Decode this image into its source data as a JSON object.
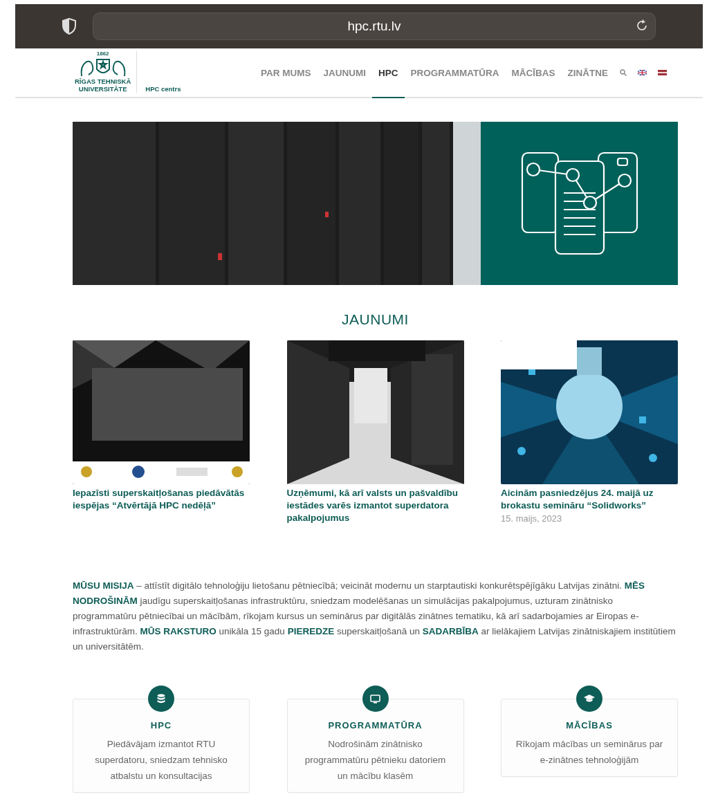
{
  "browser": {
    "url": "hpc.rtu.lv"
  },
  "header": {
    "logo": {
      "year": "1862",
      "name_line1": "RĪGAS TEHNISKĀ",
      "name_line2": "UNIVERSITĀTE",
      "subtitle": "HPC centrs"
    },
    "nav": [
      {
        "label": "PAR MUMS",
        "selected": false
      },
      {
        "label": "JAUNUMI",
        "selected": false
      },
      {
        "label": "HPC",
        "selected": true
      },
      {
        "label": "PROGRAMMATŪRA",
        "selected": false
      },
      {
        "label": "MĀCĪBAS",
        "selected": false
      },
      {
        "label": "ZINĀTNE",
        "selected": false
      }
    ]
  },
  "news": {
    "heading": "JAUNUMI",
    "items": [
      {
        "title": "Iepazīsti superskaitļošanas piedāvātās iespējas “Atvērtājā HPC nedēļā”"
      },
      {
        "title": "Uzņēmumi, kā arī valsts un pašvaldību iestādes varēs izmantot superdatora pakalpojumus"
      },
      {
        "title": "Aicinām pasniedzējus 24. maijā uz brokastu semināru “Solidworks”",
        "date": "15. maijs, 2023"
      }
    ]
  },
  "mission": "**MŪSU MISIJA** – attīstīt digitālo tehnoloģiju lietošanu pētniecībā; veicināt modernu un starptautiski konkurētspējīgāku Latvijas zinātni. **MĒS NODROŠINĀM** jaudīgu superskaitļošanas infrastruktūru, sniedzam modelēšanas un simulācijas pakalpojumus, uzturam zinātnisko programmatūru pētniecībai un mācībām, rīkojam kursus un seminārus par digitālās zinātnes tematiku, kā arī sadarbojamies ar Eiropas e-infrastruktūrām. **MŪS RAKSTURO** unikāla 15 gadu **PIEREDZE** superskaitļošanā un **SADARBĪBA** ar lielākajiem Latvijas zinātniskajiem institūtiem un universitātēm.",
  "services": [
    {
      "title": "HPC",
      "text": "Piedāvājam izmantot RTU superdatoru, sniedzam tehnisko atbalstu un konsultacijas"
    },
    {
      "title": "PROGRAMMATŪRA",
      "text": "Nodrošinām zinātnisko programmatūru pētnieku datoriem un mācību klasēm"
    },
    {
      "title": "MĀCĪBAS",
      "text": "Rīkojam mācības un seminārus par e-zinātnes tehnoloģijām"
    }
  ]
}
